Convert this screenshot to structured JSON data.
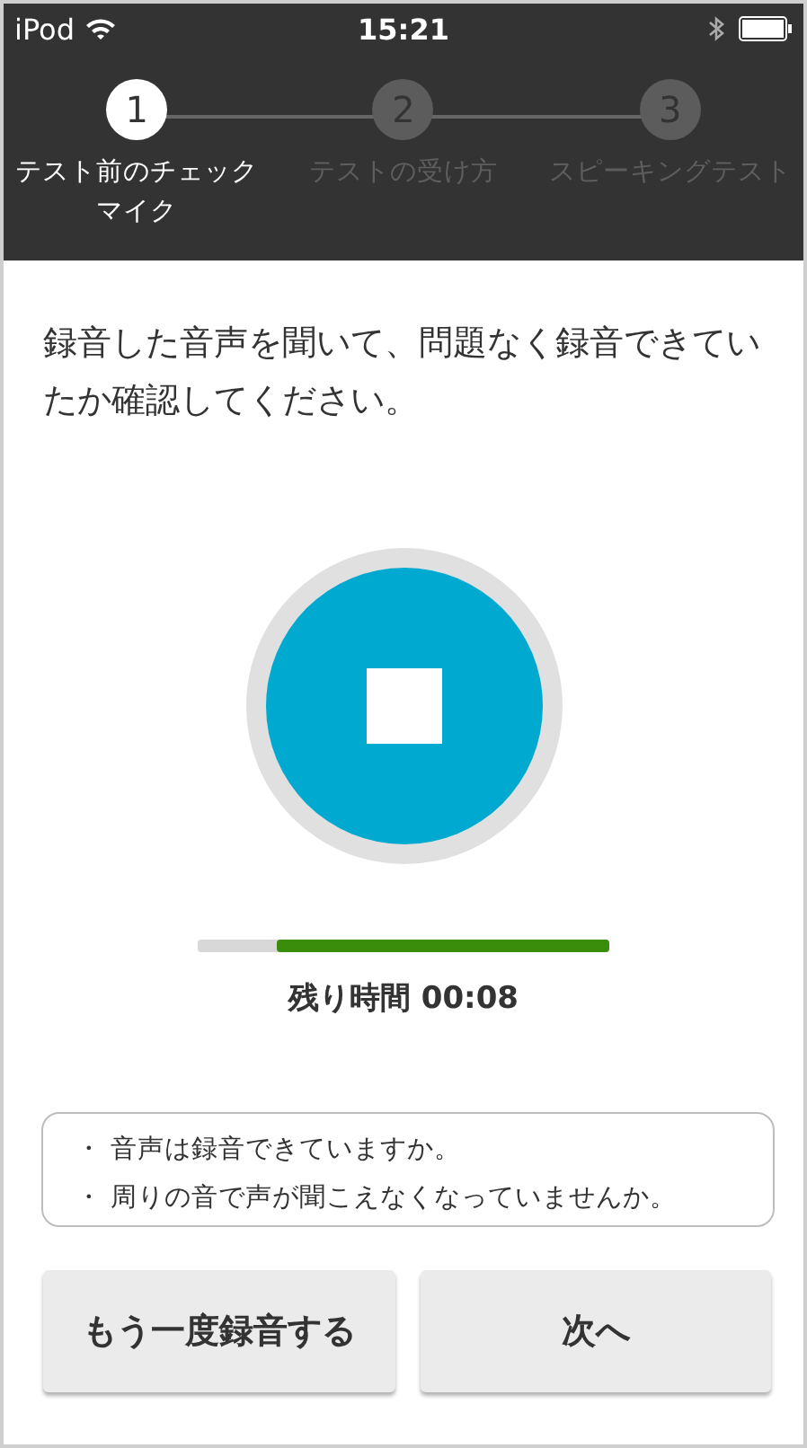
{
  "status_bar": {
    "carrier": "iPod",
    "time": "15:21"
  },
  "steps": [
    {
      "number": "1",
      "label": "テスト前のチェック",
      "sublabel": "マイク",
      "selected": true
    },
    {
      "number": "2",
      "label": "テストの受け方",
      "selected": false
    },
    {
      "number": "3",
      "label": "スピーキングテスト",
      "selected": false
    }
  ],
  "instruction": "録音した音声を聞いて、問題なく録音できていたか確認してください。",
  "recorder": {
    "recording": true
  },
  "timer": {
    "level": 0.81,
    "label": "残り時間 00:08"
  },
  "checklist": [
    "・ 音声は録音できていますか。",
    "・ 周りの音で声が聞こえなくなっていませんか。"
  ],
  "buttons": [
    "もう一度録音する",
    "次へ"
  ]
}
